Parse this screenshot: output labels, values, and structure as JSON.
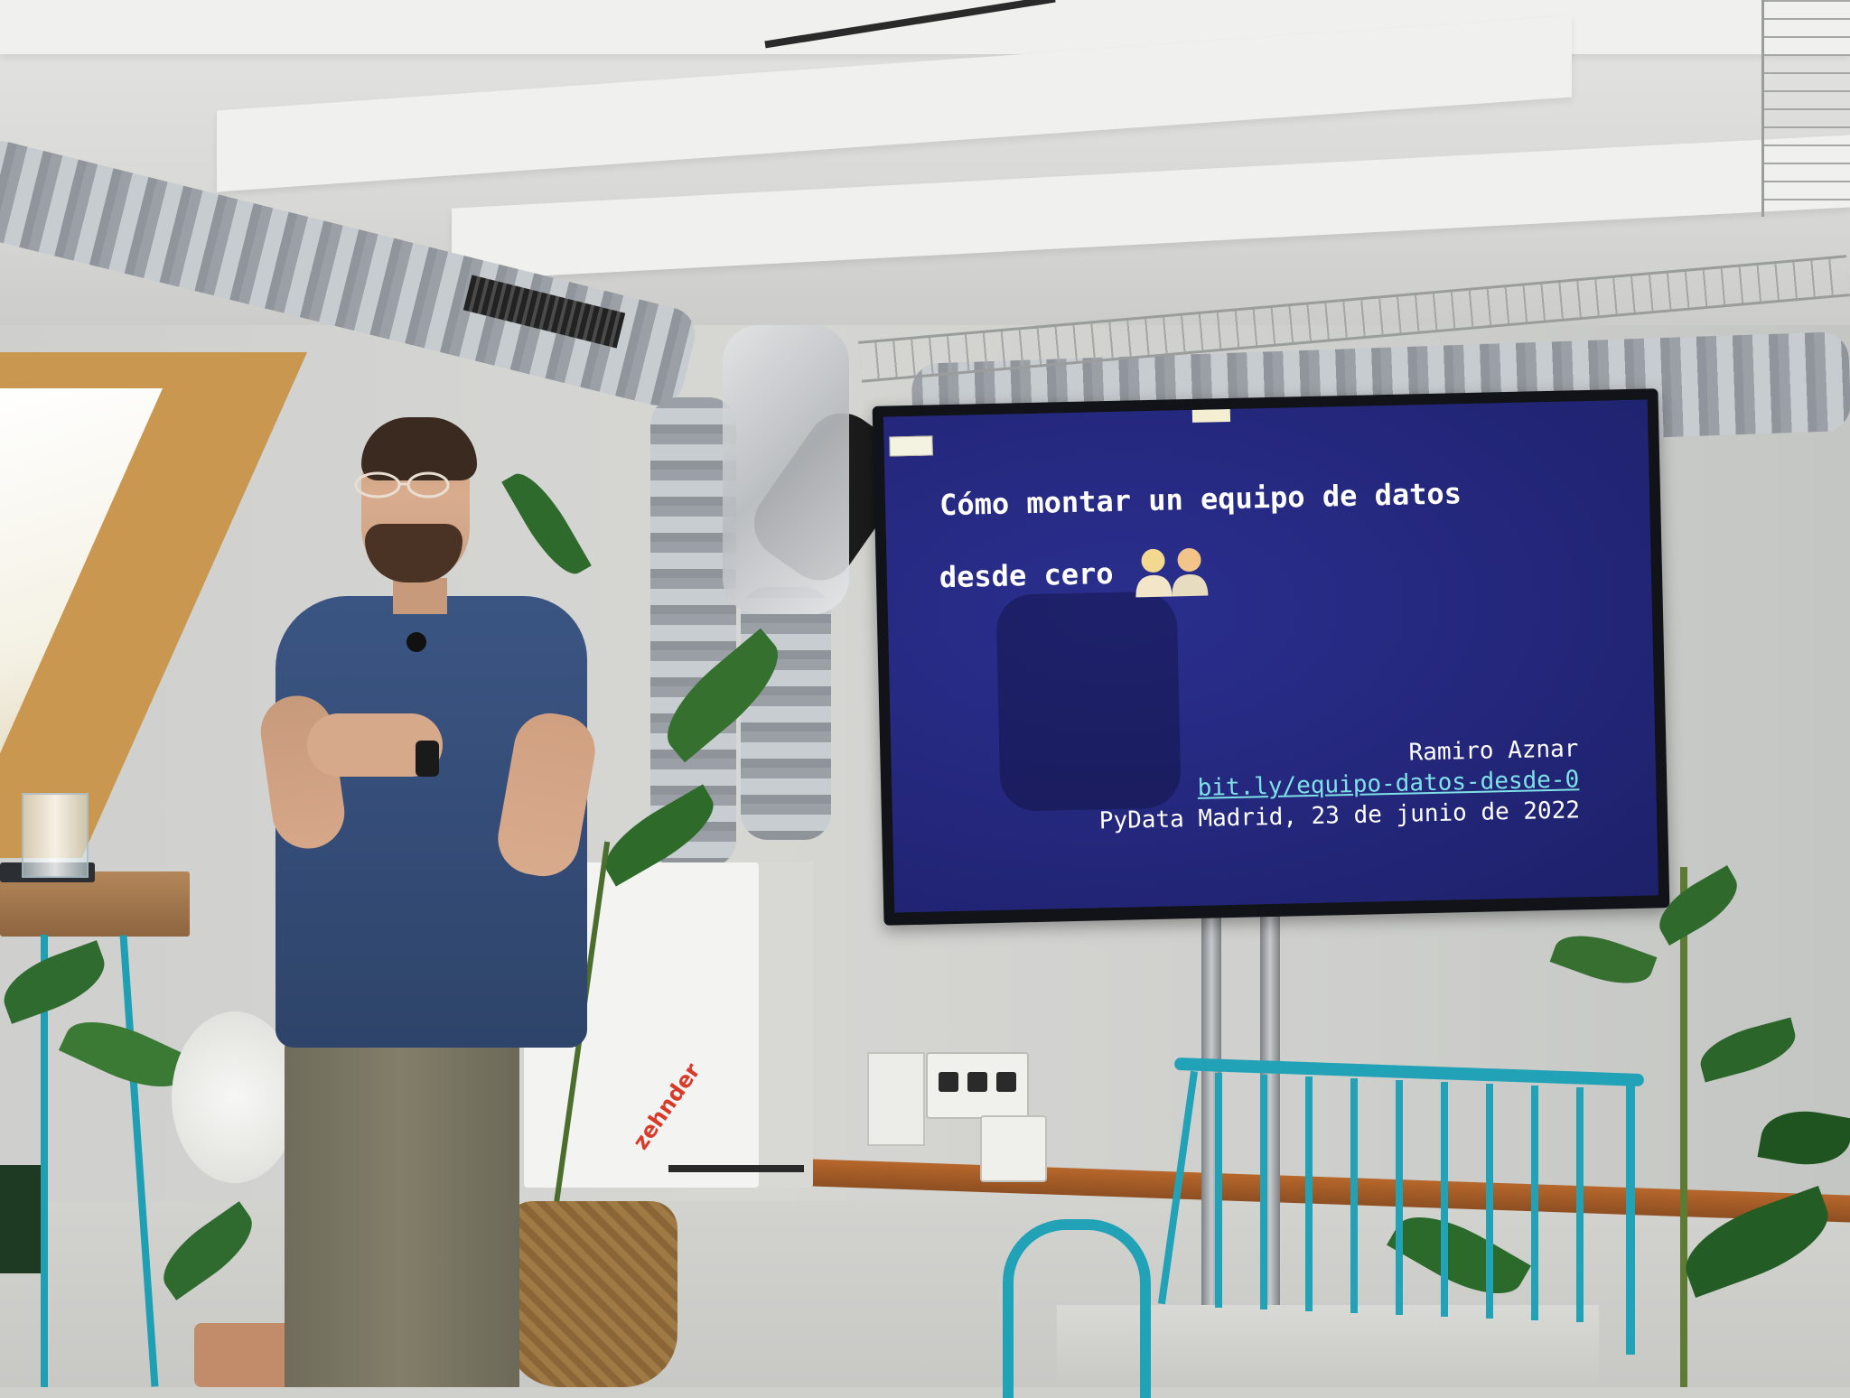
{
  "slide": {
    "title_line1": "Cómo montar un equipo de datos",
    "title_line2": "desde cero",
    "author": "Ramiro Aznar",
    "link": "bit.ly/equipo-datos-desde-0",
    "event": "PyData Madrid, 23 de junio de 2022"
  },
  "ventilation_unit": {
    "brand": "zehnder"
  },
  "colors": {
    "slide_background": "#232679",
    "link_color": "#7fe0e8",
    "chair_color": "#22a2b7",
    "shirt_color": "#3b5583"
  }
}
